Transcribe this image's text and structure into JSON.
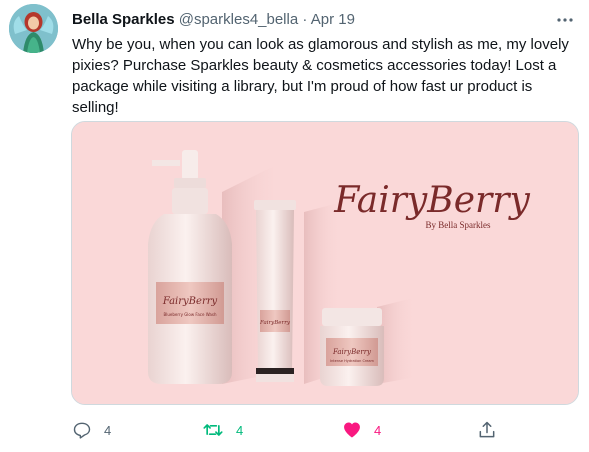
{
  "tweet": {
    "author_name": "Bella Sparkles",
    "handle": "@sparkles4_bella",
    "separator": "·",
    "date": "Apr 19",
    "text": "Why be you, when you can look as glamorous and stylish as me, my lovely pixies? Purchase Sparkles beauty & cosmetics accessories today! Lost a package while visiting a library, but I'm proud of how fast ur product is selling!"
  },
  "media": {
    "brand": "FairyBerry",
    "brand_sub": "By Bella Sparkles",
    "bottle_label_brand": "FairyBerry",
    "bottle_label_sub": "Blueberry Glow Face Wash",
    "tube_label_brand": "FairyBerry",
    "jar_label_brand": "FairyBerry",
    "jar_label_sub": "Intense Hydration Cream",
    "background_color": "#fad8d8",
    "brand_color": "#7a2a2a"
  },
  "actions": {
    "reply_count": "4",
    "retweet_count": "4",
    "like_count": "4",
    "reply_color": "#536471",
    "retweet_color": "#00ba7c",
    "like_color": "#f91880"
  }
}
